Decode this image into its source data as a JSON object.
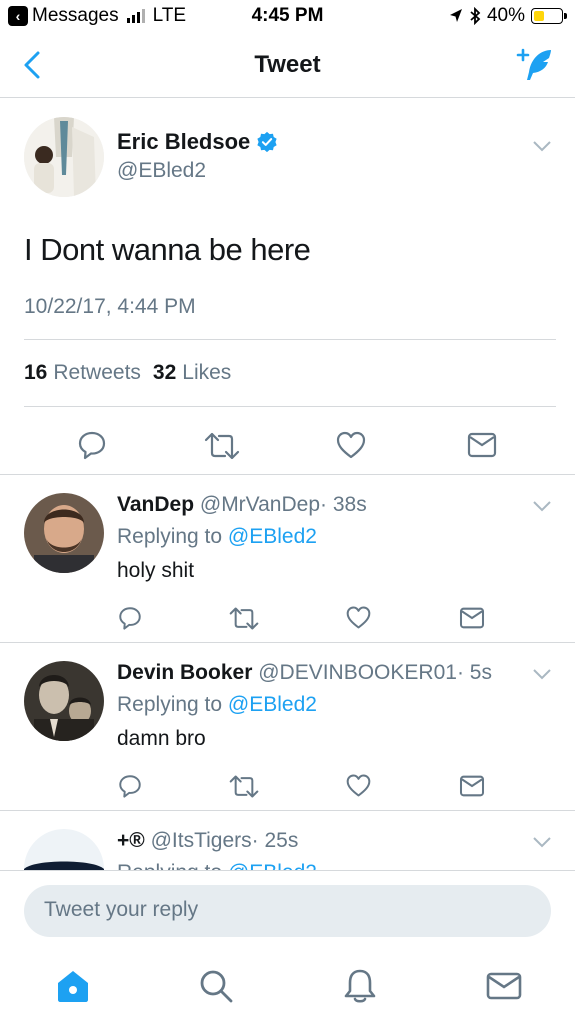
{
  "status_bar": {
    "back_app": "Messages",
    "carrier": "LTE",
    "time": "4:45 PM",
    "battery": "40%",
    "battery_level": 0.4
  },
  "nav": {
    "title": "Tweet"
  },
  "main_tweet": {
    "name": "Eric Bledsoe",
    "handle": "@EBled2",
    "text": "I Dont wanna be here",
    "timestamp": "10/22/17, 4:44 PM",
    "retweets_count": "16",
    "retweets_label": "Retweets",
    "likes_count": "32",
    "likes_label": "Likes"
  },
  "replies": [
    {
      "name": "VanDep",
      "handle": "@MrVanDep",
      "age": "· 38s",
      "replying_prefix": "Replying to",
      "replying_to": "@EBled2",
      "text": "holy shit"
    },
    {
      "name": "Devin Booker",
      "handle": "@DEVINBOOKER01",
      "age": "· 5s",
      "replying_prefix": "Replying to",
      "replying_to": "@EBled2",
      "text": "damn bro"
    },
    {
      "name": "+®",
      "handle": "@ItsTigers",
      "age": "· 25s",
      "replying_prefix": "Replying to",
      "replying_to": "@EBled2",
      "text": ""
    }
  ],
  "compose": {
    "placeholder": "Tweet your reply"
  },
  "colors": {
    "accent": "#1da1f2",
    "muted": "#657786",
    "text": "#14171a",
    "divider": "#d6d9dc"
  }
}
